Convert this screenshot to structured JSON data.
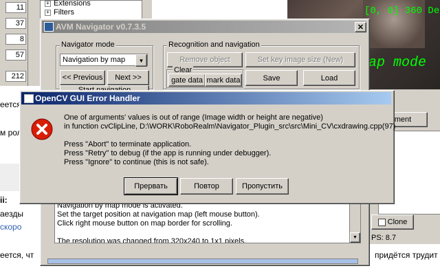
{
  "background": {
    "left_numbers": [
      "11",
      "37",
      "8",
      "57",
      "212"
    ],
    "left_fragments": [
      "еется",
      "м рол",
      "ii:",
      "аезды",
      "скоро"
    ],
    "bottom_fragment_left": "еется, чт",
    "bottom_fragment_right": "придётся трудит",
    "tree_items": [
      "Extensions",
      "Filters"
    ],
    "overlay_coords": "[0, 0] 360 De",
    "overlay_mode": "ap mode",
    "right_panel_button": "ment",
    "clone_button": "Clone",
    "fps_text": "PS: 8.7"
  },
  "navigator": {
    "title": "AVM Navigator v0.7.3.5",
    "nav_mode_group": "Navigator mode",
    "nav_mode_value": "Navigation by map",
    "prev_button": "<< Previous",
    "next_button": "Next >>",
    "start_button_partial": "Start navigation",
    "recog_group": "Recognition and navigation",
    "remove_object": "Remove object",
    "set_key_image": "Set key image size (New)",
    "clear_group": "Clear",
    "gate_data": "gate data",
    "mark_data": "mark data",
    "save": "Save",
    "load": "Load",
    "log_lines": [
      "Navigation by map mode is activated.",
      "Set the target position at navigation map (left mouse button).",
      "Click right mouse button on map border for scrolling.",
      "",
      "The resolution was changed from 320x240 to 1x1 pixels."
    ]
  },
  "dialog": {
    "title": "OpenCV GUI Error Handler",
    "message_line1": "One of arguments' values is out of range (Image width or height are negative)",
    "message_line2": "in function cvClipLine, D:\\WORK\\RoboRealm\\Navigator_Plugin_src\\src\\Mini_CV\\cxdrawing.cpp(97)",
    "hint_abort": "Press \"Abort\" to terminate application.",
    "hint_retry": "Press \"Retry\" to debug (if the app is running under debugger).",
    "hint_ignore": "Press \"Ignore\" to continue (this is not safe).",
    "btn_abort": "Прервать",
    "btn_retry": "Повтор",
    "btn_ignore": "Пропустить"
  },
  "colors": {
    "accent_title": "#0a246a",
    "error_red": "#d81e05",
    "overlay_green": "#00ff00",
    "dialog_gray": "#d4d0c8"
  }
}
